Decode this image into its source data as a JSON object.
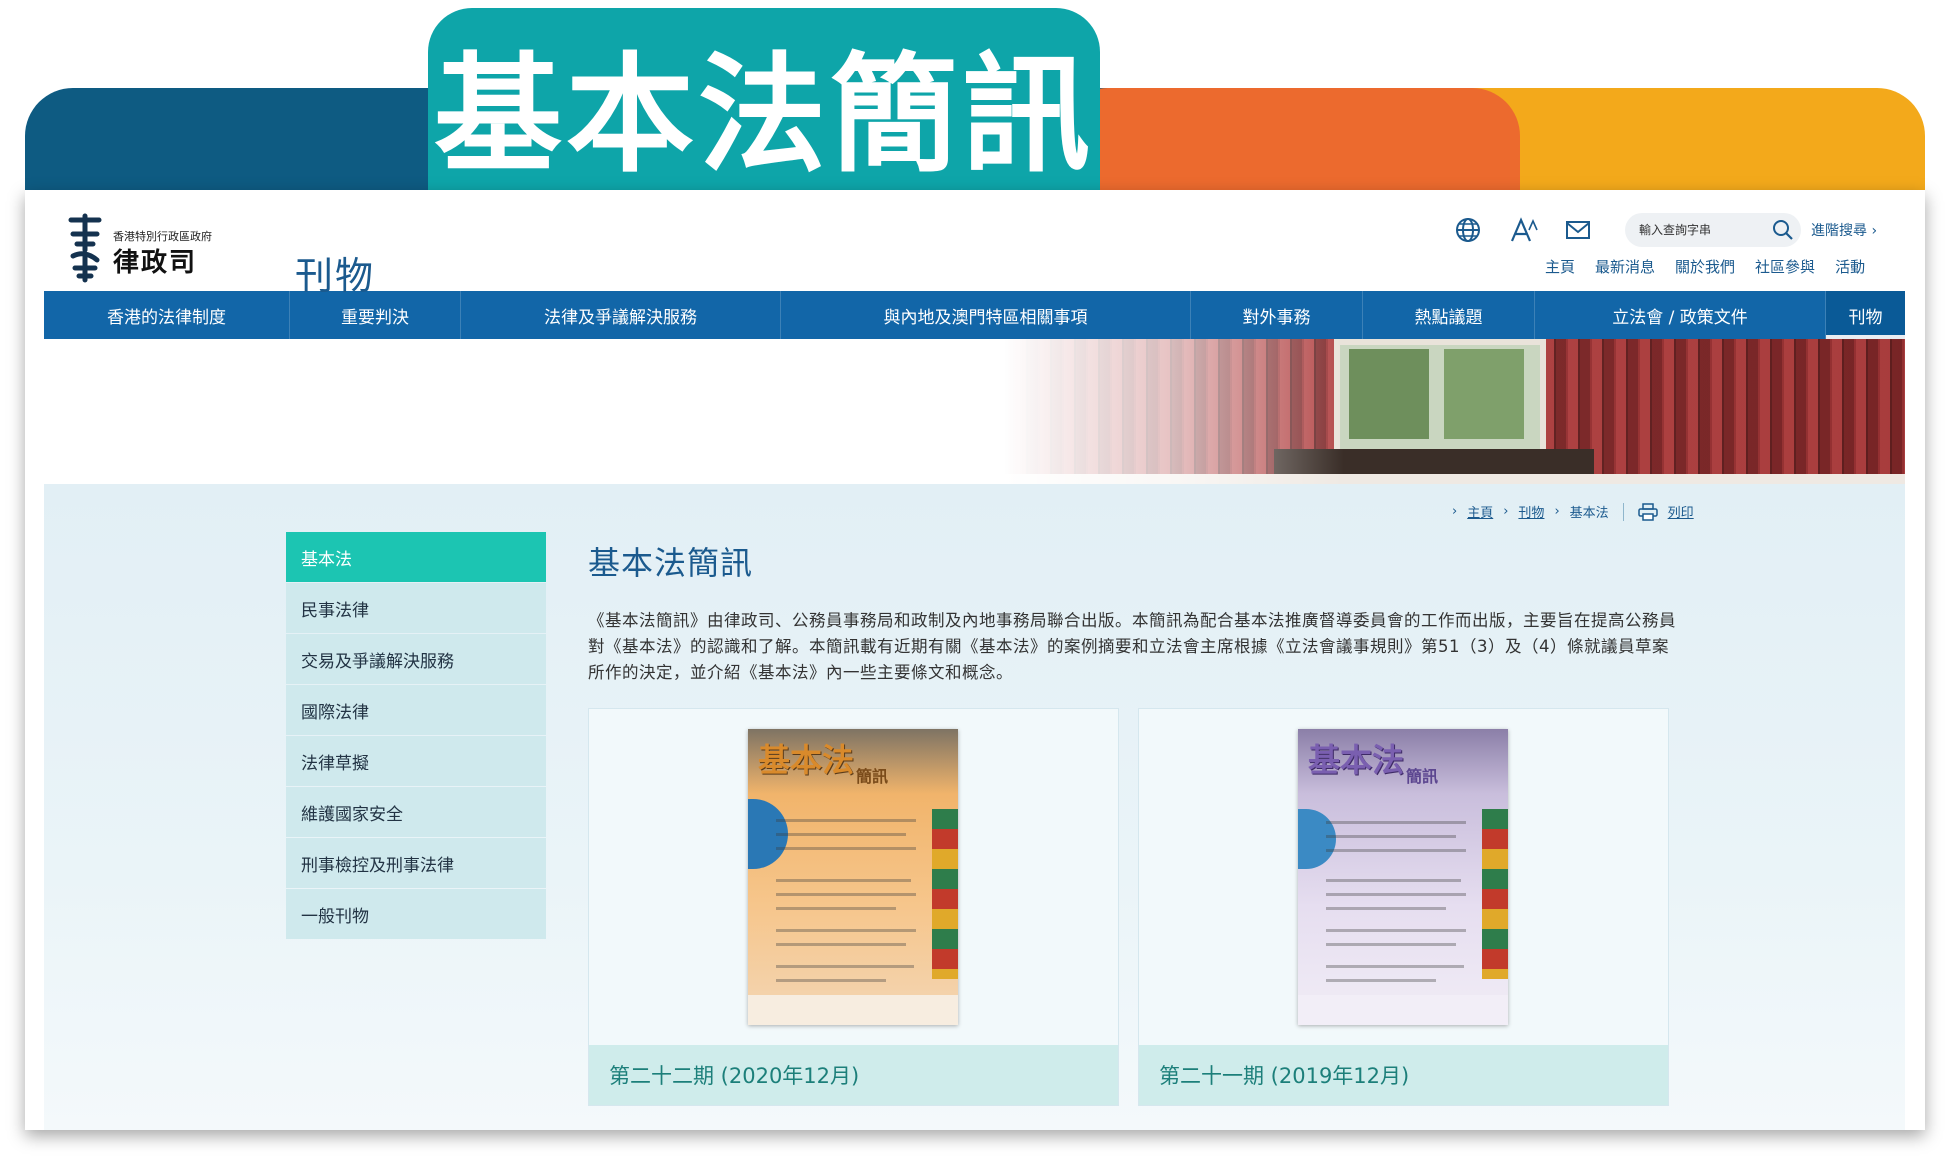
{
  "banner": {
    "title": "基本法簡訊"
  },
  "header": {
    "org_small": "香港特別行政區政府",
    "org_name": "律政司",
    "search_placeholder": "輸入查詢字串",
    "advanced_search": "進階搜尋 ›",
    "icons": [
      "globe-icon",
      "font-size-icon",
      "mail-icon",
      "search-icon"
    ],
    "quick_links": [
      "主頁",
      "最新消息",
      "關於我們",
      "社區參與",
      "活動"
    ]
  },
  "nav": [
    "香港的法律制度",
    "重要判決",
    "法律及爭議解決服務",
    "與內地及澳門特區相關事項",
    "對外事務",
    "熱點議題",
    "立法會 / 政策文件",
    "刊物"
  ],
  "hero": {
    "title": "刊物"
  },
  "breadcrumb": {
    "items": [
      "主頁",
      "刊物",
      "基本法"
    ],
    "print": "列印"
  },
  "sidebar": {
    "items": [
      "基本法",
      "民事法律",
      "交易及爭議解決服務",
      "國際法律",
      "法律草擬",
      "維護國家安全",
      "刑事檢控及刑事法律",
      "一般刊物"
    ],
    "active_index": 0
  },
  "main": {
    "title": "基本法簡訊",
    "intro": "《基本法簡訊》由律政司、公務員事務局和政制及內地事務局聯合出版。本簡訊為配合基本法推廣督導委員會的工作而出版，主要旨在提高公務員對《基本法》的認識和了解。本簡訊載有近期有關《基本法》的案例摘要和立法會主席根據《立法會議事規則》第51（3）及（4）條就議員草案所作的決定，並介紹《基本法》內一些主要條文和概念。",
    "publications": [
      {
        "caption": "第二十二期 (2020年12月)",
        "cover_title": "基本法",
        "cover_sub": "簡訊"
      },
      {
        "caption": "第二十一期 (2019年12月)",
        "cover_title": "基本法",
        "cover_sub": "簡訊"
      }
    ]
  },
  "colors": {
    "banner_blue": "#0e5b82",
    "banner_teal": "#0ea5a9",
    "banner_orange": "#ec6a2e",
    "banner_yellow": "#f3a91b",
    "nav_blue": "#1266a8",
    "sidebar_active": "#1cc5b2",
    "title_blue": "#1b5a8e"
  }
}
